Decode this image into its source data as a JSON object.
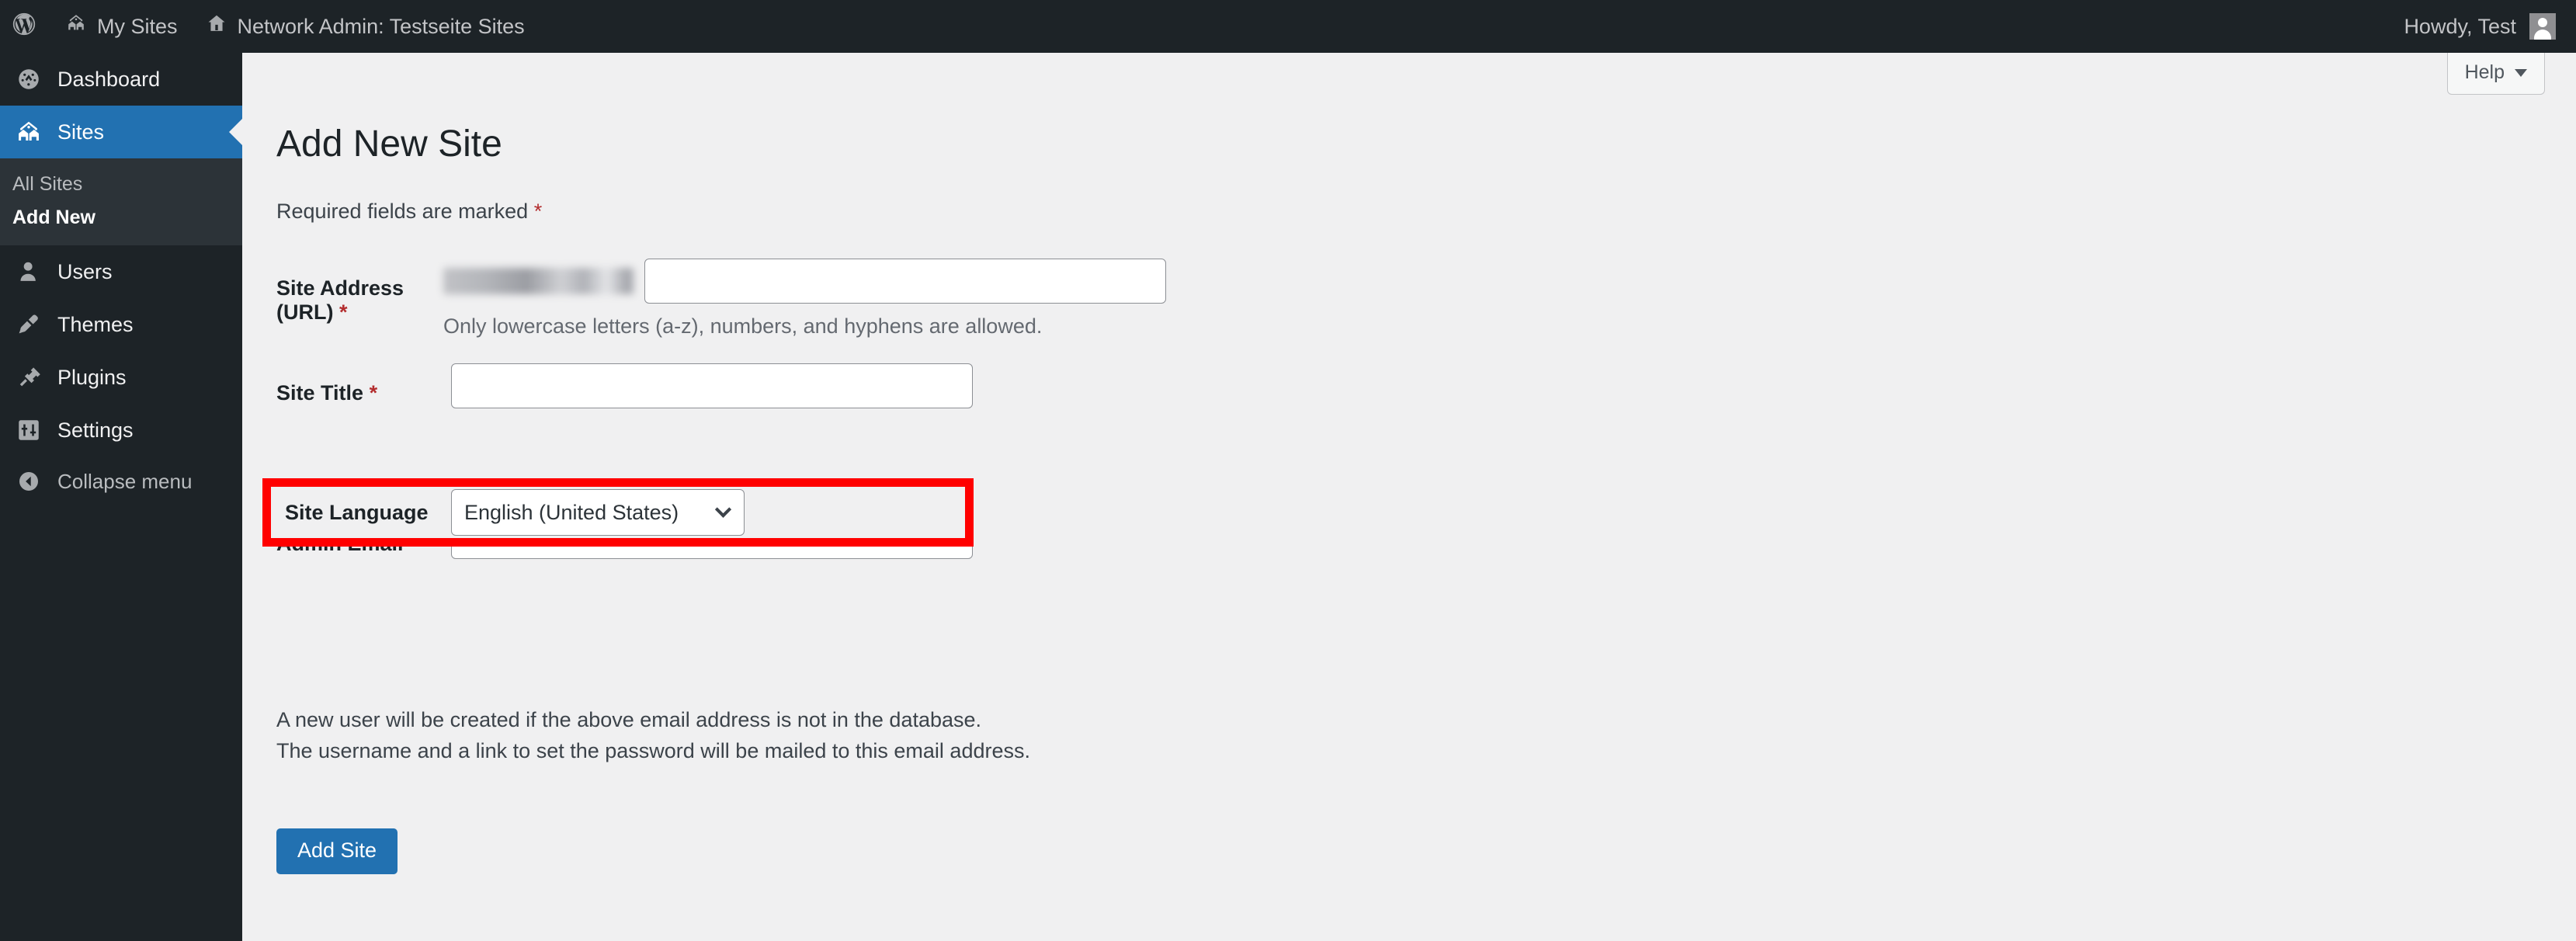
{
  "adminbar": {
    "wordpress_logo": "wordpress-logo",
    "my_sites": "My Sites",
    "network_admin": "Network Admin: Testseite Sites",
    "howdy": "Howdy, Test"
  },
  "sidebar": {
    "items": [
      {
        "label": "Dashboard",
        "icon": "dashboard-icon",
        "active": false
      },
      {
        "label": "Sites",
        "icon": "sites-icon",
        "active": true
      },
      {
        "label": "Users",
        "icon": "users-icon",
        "active": false
      },
      {
        "label": "Themes",
        "icon": "themes-icon",
        "active": false
      },
      {
        "label": "Plugins",
        "icon": "plugins-icon",
        "active": false
      },
      {
        "label": "Settings",
        "icon": "settings-icon",
        "active": false
      }
    ],
    "submenu": [
      {
        "label": "All Sites",
        "current": false
      },
      {
        "label": "Add New",
        "current": true
      }
    ],
    "collapse": "Collapse menu"
  },
  "content": {
    "help_button": "Help",
    "page_title": "Add New Site",
    "required_note": "Required fields are marked",
    "required_marker": "*",
    "fields": {
      "site_address": {
        "label": "Site Address (URL)",
        "required": true,
        "url_prefix": "",
        "value": "",
        "placeholder": "",
        "help": "Only lowercase letters (a-z), numbers, and hyphens are allowed."
      },
      "site_title": {
        "label": "Site Title",
        "required": true,
        "value": "",
        "placeholder": ""
      },
      "site_language": {
        "label": "Site Language",
        "required": false,
        "selected": "English (United States)",
        "options": [
          "English (United States)"
        ]
      },
      "admin_email": {
        "label": "Admin Email",
        "required": true,
        "value": "",
        "placeholder": ""
      }
    },
    "note_line_1": "A new user will be created if the above email address is not in the database.",
    "note_line_2": "The username and a link to set the password will be mailed to this email address.",
    "submit_label": "Add Site"
  },
  "colors": {
    "admin_dark": "#1d2327",
    "submenu_dark": "#2c3338",
    "accent_blue": "#2271b1",
    "content_bg": "#f0f0f1",
    "required_red": "#b32d2e",
    "highlight_red": "#ff0000"
  }
}
